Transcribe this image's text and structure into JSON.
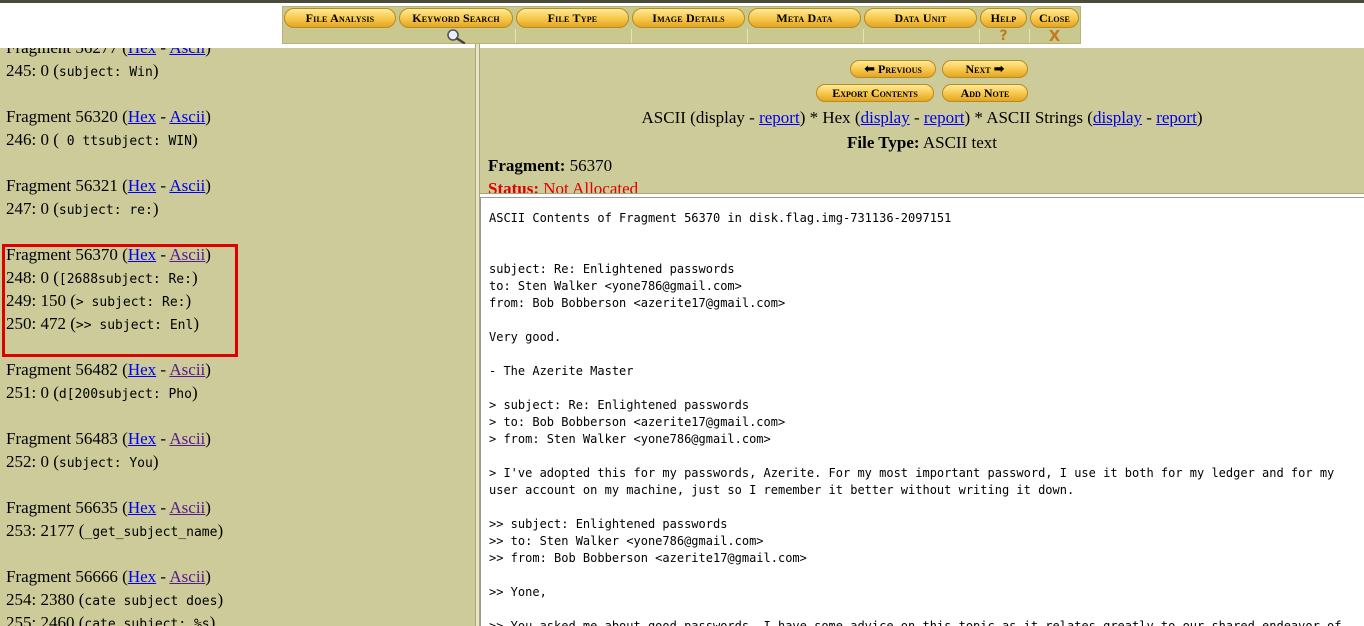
{
  "toolbar": {
    "file_analysis": "File Analysis",
    "keyword_search": "Keyword Search",
    "file_type": "File Type",
    "image_details": "Image Details",
    "meta_data": "Meta Data",
    "data_unit": "Data Unit",
    "help": "Help",
    "help_sub": "?",
    "close": "Close",
    "close_sub": "X"
  },
  "left": {
    "fragments": [
      {
        "head": "Fragment 56277",
        "lines": [
          {
            "num": "245: 0",
            "text": "subject: Win"
          }
        ]
      },
      {
        "head": "Fragment 56320",
        "lines": [
          {
            "num": "246: 0",
            "text": " 0 ttsubject: WIN"
          }
        ]
      },
      {
        "head": "Fragment 56321",
        "lines": [
          {
            "num": "247: 0",
            "text": "subject: re:"
          }
        ]
      },
      {
        "head": "Fragment 56370",
        "lines": [
          {
            "num": "248: 0",
            "text": "[2688subject: Re:"
          },
          {
            "num": "249: 150",
            "text": "> subject: Re:"
          },
          {
            "num": "250: 472",
            "text": ">> subject: Enl"
          }
        ]
      },
      {
        "head": "Fragment 56482",
        "lines": [
          {
            "num": "251: 0",
            "text": "d[200subject: Pho"
          }
        ]
      },
      {
        "head": "Fragment 56483",
        "lines": [
          {
            "num": "252: 0",
            "text": "subject: You"
          }
        ]
      },
      {
        "head": "Fragment 56635",
        "lines": [
          {
            "num": "253: 2177",
            "text": "_get_subject_name"
          }
        ]
      },
      {
        "head": "Fragment 56666",
        "lines": [
          {
            "num": "254: 2380",
            "text": "cate subject does"
          },
          {
            "num": "255: 2460",
            "text": "cate subject: %s"
          }
        ]
      }
    ],
    "hex": "Hex",
    "dash": " - ",
    "ascii": "Ascii"
  },
  "right": {
    "previous": "Previous",
    "next": "Next",
    "export": "Export Contents",
    "add_note": "Add Note",
    "view": {
      "ascii_prefix": "ASCII (display - ",
      "report": "report",
      "hex_prefix": ") * Hex (",
      "display": "display",
      "dash": " - ",
      "strings_prefix": ") * ASCII Strings (",
      "close_paren": ")"
    },
    "file_type_label": "File Type:",
    "file_type_value": " ASCII text",
    "fragment_label": "Fragment:",
    "fragment_value": " 56370",
    "status_label": "Status:",
    "status_value": " Not Allocated",
    "contents": "ASCII Contents of Fragment 56370 in disk.flag.img-731136-2097151\n\n\nsubject: Re: Enlightened passwords\nto: Sten Walker <yone786@gmail.com>\nfrom: Bob Bobberson <azerite17@gmail.com>\n\nVery good.\n\n- The Azerite Master\n\n> subject: Re: Enlightened passwords\n> to: Bob Bobberson <azerite17@gmail.com>\n> from: Sten Walker <yone786@gmail.com>\n\n> I've adopted this for my passwords, Azerite. For my most important password, I use it both for my ledger and for my\nuser account on my machine, just so I remember it better without writing it down.\n\n>> subject: Enlightened passwords\n>> to: Sten Walker <yone786@gmail.com>\n>> from: Bob Bobberson <azerite17@gmail.com>\n\n>> Yone,\n\n>> You asked me about good passwords. I have some advice on this topic as it relates greatly to our shared endeavor of"
  }
}
